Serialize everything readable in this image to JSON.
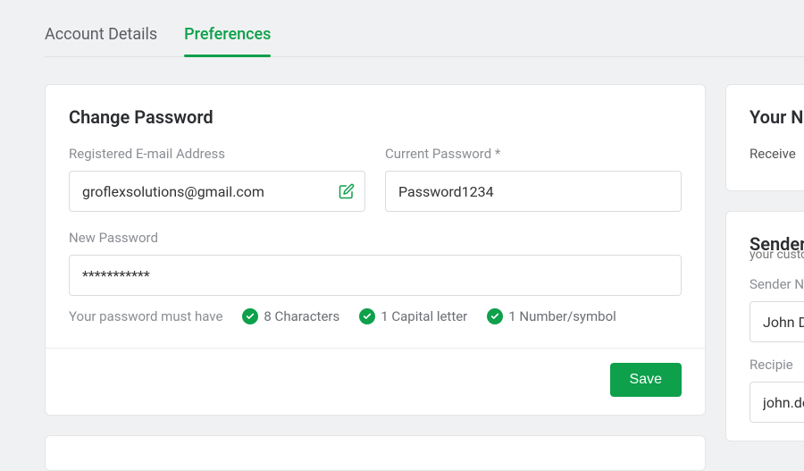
{
  "tabs": {
    "account_details": "Account Details",
    "preferences": "Preferences"
  },
  "changePassword": {
    "title": "Change Password",
    "emailLabel": "Registered E-mail Address",
    "emailValue": "groflexsolutions@gmail.com",
    "currentLabel": "Current Password *",
    "currentValue": "Password1234",
    "newLabel": "New Password",
    "newValue": "***********",
    "reqIntro": "Your password must have",
    "req1": "8 Characters",
    "req2": "1 Capital letter",
    "req3": "1 Number/symbol",
    "saveLabel": "Save"
  },
  "yourN": {
    "title": "Your N",
    "text": "Receive"
  },
  "sender": {
    "title": "Sender",
    "sub": "your custo",
    "senderNameLabel": "Sender N",
    "senderNameValue": "John D",
    "recipientLabel": "Recipie",
    "recipientValue": "john.do"
  },
  "colors": {
    "accent": "#0ea04b"
  }
}
